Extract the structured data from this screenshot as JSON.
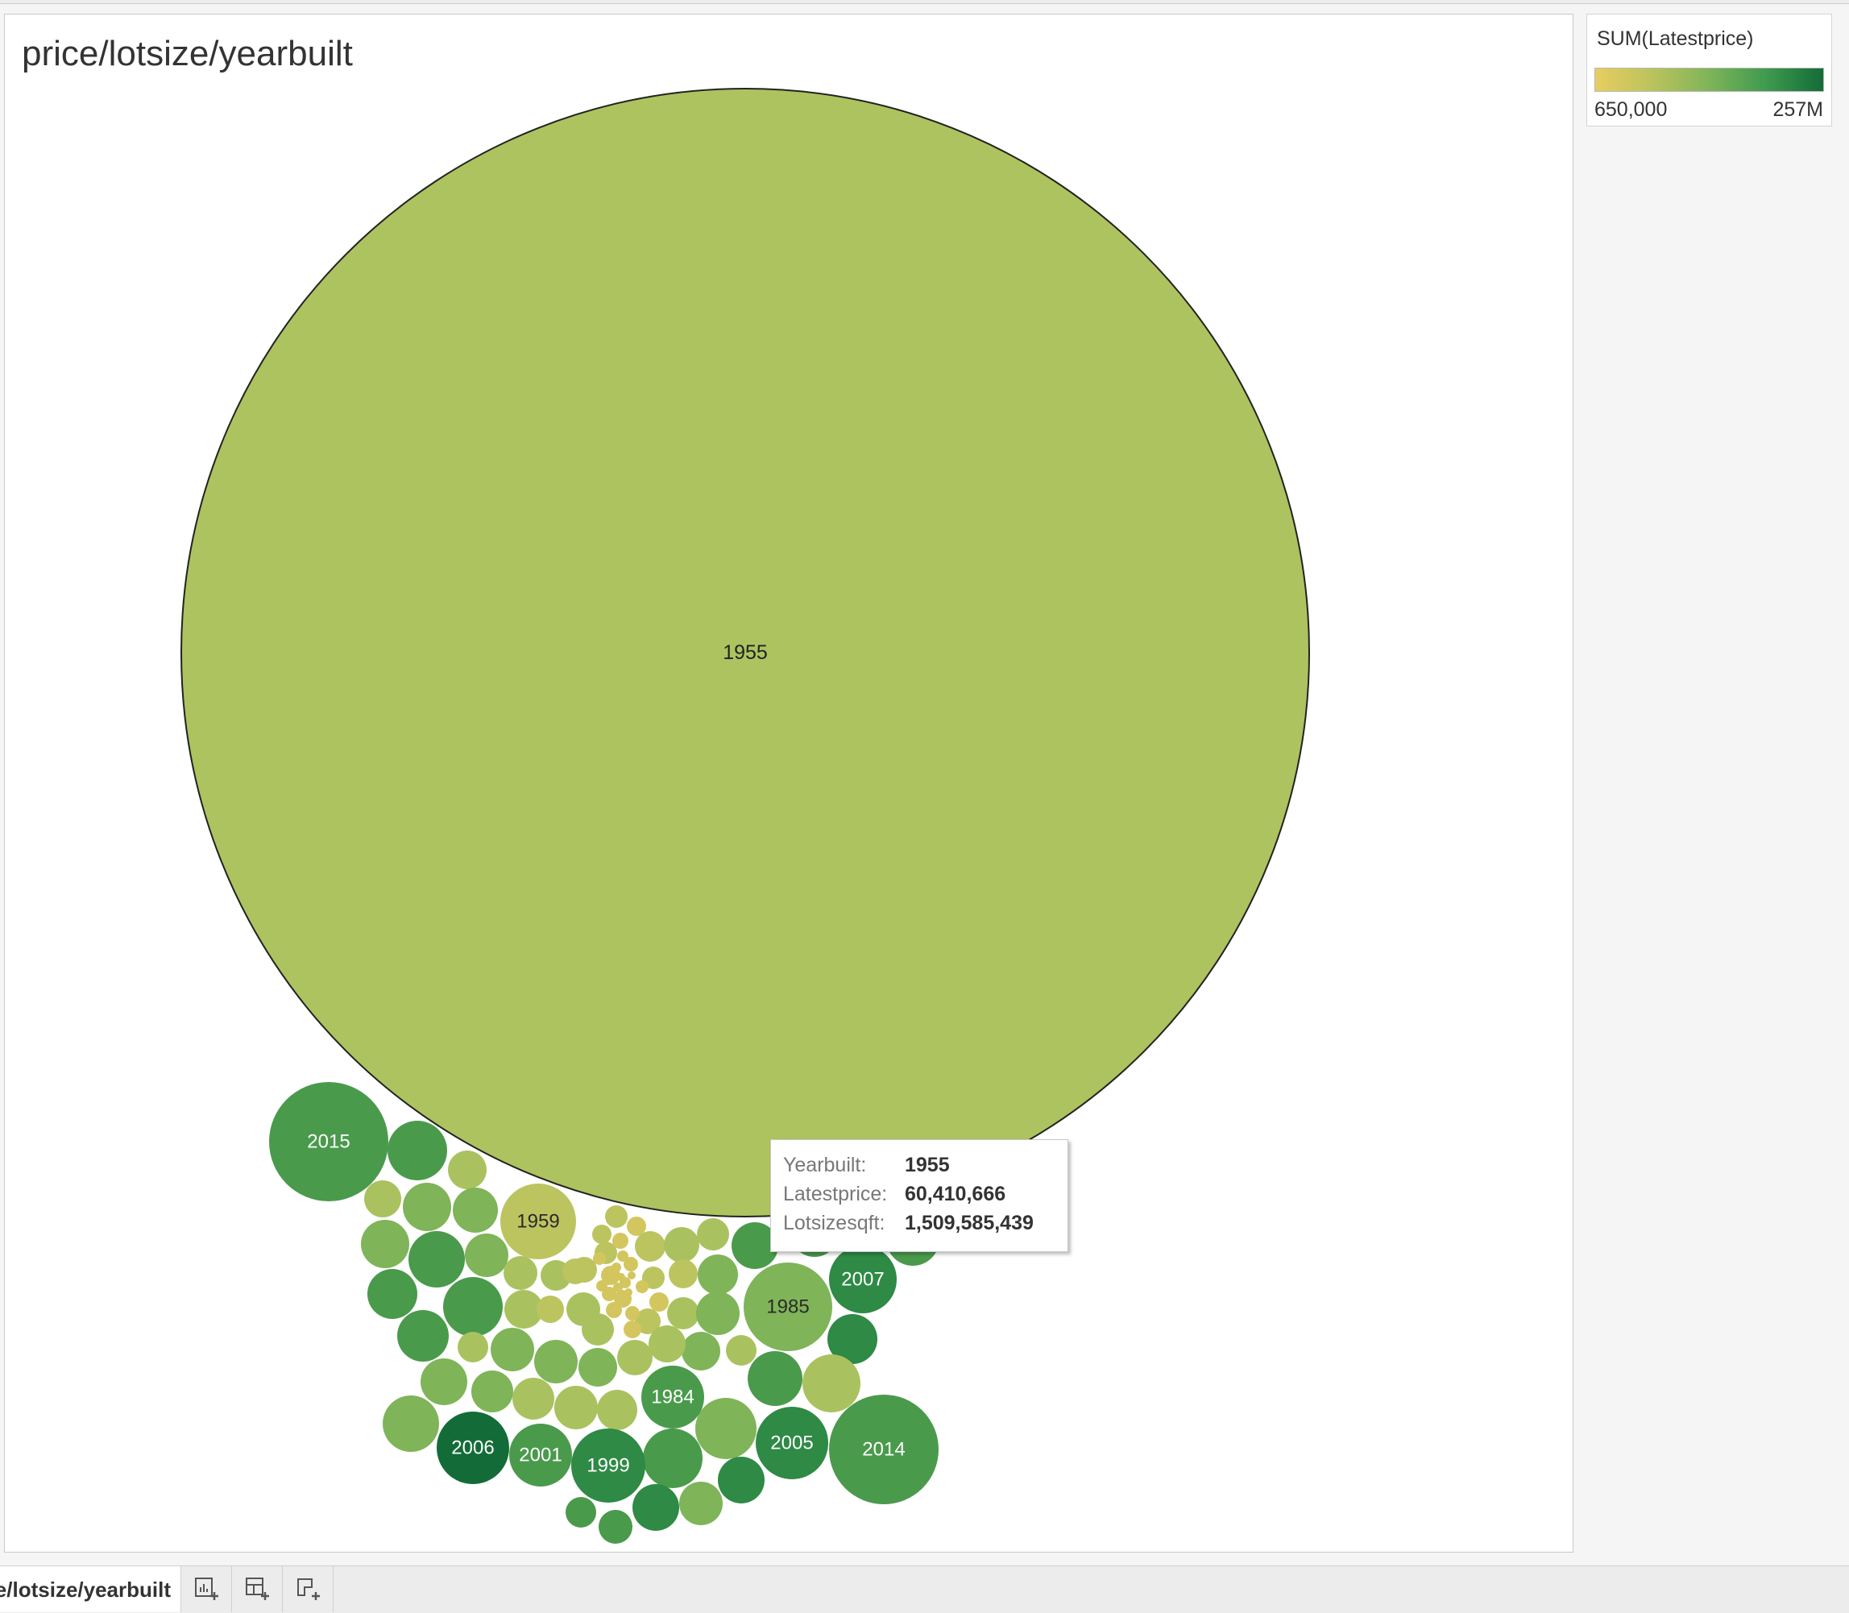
{
  "sheet": {
    "title": "price/lotsize/yearbuilt",
    "tab_label": "price/lotsize/yearbuilt"
  },
  "legend": {
    "title": "SUM(Latestprice)",
    "min_label": "650,000",
    "max_label": "257M",
    "colors": [
      "#e8cd60",
      "#bbc35d",
      "#7fb459",
      "#3f9a4f",
      "#136c37"
    ]
  },
  "tooltip": {
    "rows": [
      {
        "label": "Yearbuilt:",
        "value": "1955"
      },
      {
        "label": "Latestprice:",
        "value": "60,410,666"
      },
      {
        "label": "Lotsizesqft:",
        "value": "1,509,585,439"
      }
    ]
  },
  "toolbar": {
    "icons": [
      "new-worksheet-icon",
      "new-dashboard-icon",
      "new-story-icon"
    ]
  },
  "chart_data": {
    "type": "packed-bubble",
    "title": "price/lotsize/yearbuilt",
    "size_measure": "Lotsizesqft",
    "color_measure": "SUM(Latestprice)",
    "color_range": [
      650000,
      257000000
    ],
    "labeled_bubbles": [
      {
        "year": "1955",
        "latestprice": 60410666,
        "lotsizesqft": 1509585439
      },
      {
        "year": "2015"
      },
      {
        "year": "1959"
      },
      {
        "year": "2007"
      },
      {
        "year": "1985"
      },
      {
        "year": "1984"
      },
      {
        "year": "2006"
      },
      {
        "year": "2001"
      },
      {
        "year": "1999"
      },
      {
        "year": "2005"
      },
      {
        "year": "2014"
      }
    ]
  }
}
